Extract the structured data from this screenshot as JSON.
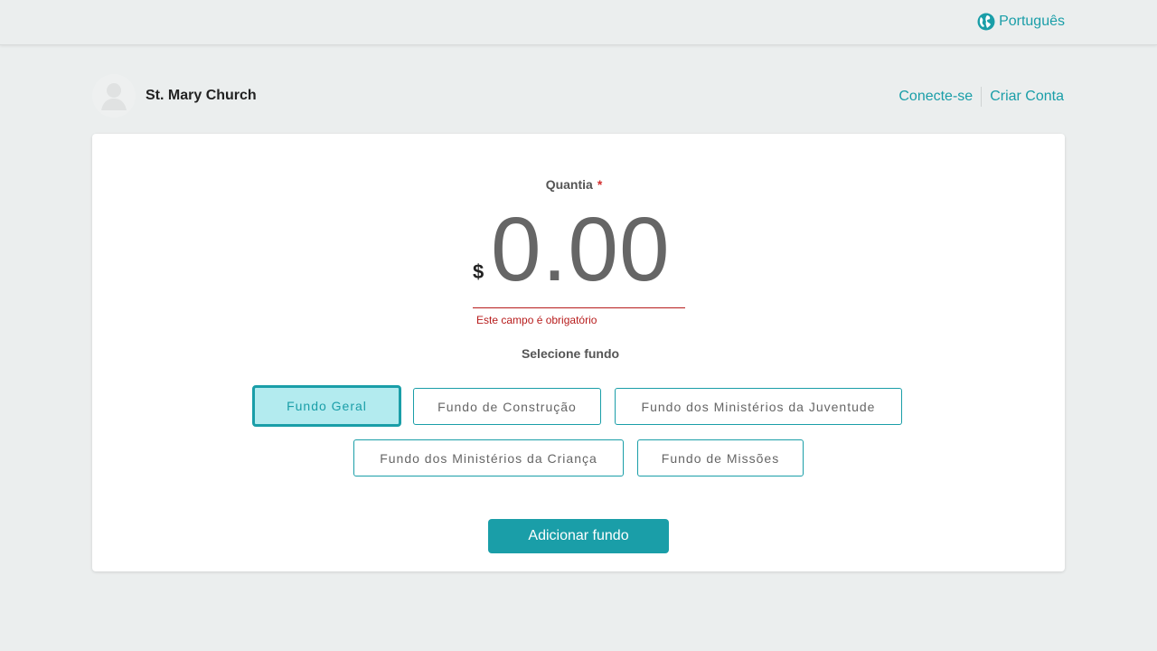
{
  "header": {
    "language_label": "Português",
    "accent_color": "#1a9ea8"
  },
  "org": {
    "name": "St. Mary Church"
  },
  "auth": {
    "login_label": "Conecte-se",
    "signup_label": "Criar Conta"
  },
  "donation": {
    "amount_label": "Quantia",
    "required_marker": "*",
    "currency_symbol": "$",
    "amount_value": "0.00",
    "error_message": "Este campo é obrigatório",
    "fund_label": "Selecione fundo",
    "funds": [
      {
        "label": "Fundo Geral",
        "selected": true
      },
      {
        "label": "Fundo de Construção",
        "selected": false
      },
      {
        "label": "Fundo dos Ministérios da Juventude",
        "selected": false
      },
      {
        "label": "Fundo dos Ministérios da Criança",
        "selected": false
      },
      {
        "label": "Fundo de Missões",
        "selected": false
      }
    ],
    "add_fund_label": "Adicionar fundo"
  }
}
